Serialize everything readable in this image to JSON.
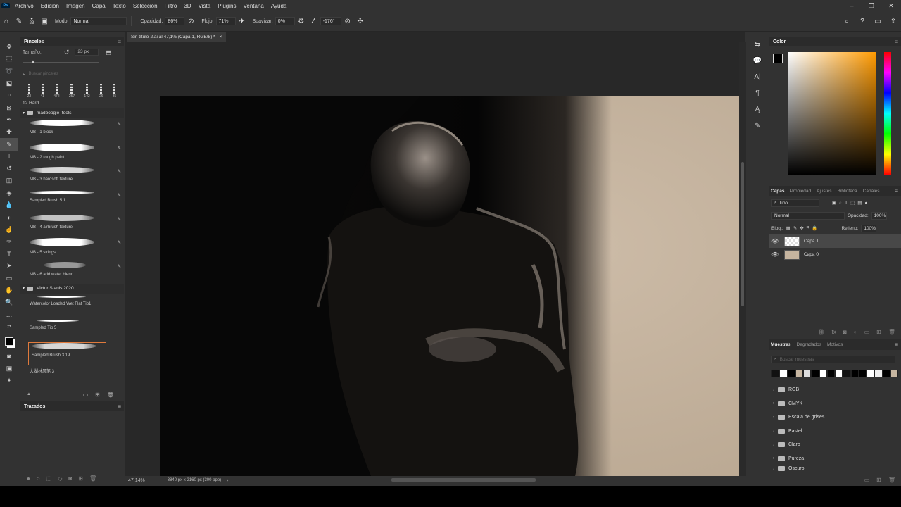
{
  "menu": {
    "items": [
      "Archivo",
      "Edición",
      "Imagen",
      "Capa",
      "Texto",
      "Selección",
      "Filtro",
      "3D",
      "Vista",
      "Plugins",
      "Ventana",
      "Ayuda"
    ]
  },
  "options": {
    "brush_size": "23",
    "mode_label": "Modo:",
    "mode_value": "Normal",
    "opacity_label": "Opacidad:",
    "opacity_value": "86%",
    "flow_label": "Flujo:",
    "flow_value": "71%",
    "smooth_label": "Suavizar:",
    "smooth_value": "0%",
    "angle_value": "-176°"
  },
  "document": {
    "tab_title": "Sin título-2.ai al 47,1% (Capa 1, RGB/8) *",
    "zoom": "47,14%",
    "dimensions": "3840 px x 2160 px (300 ppp)"
  },
  "brushes": {
    "title": "Pinceles",
    "size_label": "Tamaño:",
    "size_value": "23 px",
    "search_placeholder": "Buscar pinceles",
    "presets": [
      "23",
      "41",
      "472",
      "257",
      "142",
      "26",
      "35"
    ],
    "current": "12 Hard",
    "group1": "madboogie_tools",
    "items1": [
      "MB - 1 block",
      "MB - 2 rough paint",
      "MB - 3 hardsoft texture",
      "Sampled Brush 5 1",
      "MB - 4 airbrush texture",
      "MB - 5 strings",
      "MB - 6 add water blend"
    ],
    "group2": "Victor Stanis 2020",
    "items2": [
      "Watercolor Loaded Wet Flat Tip1",
      "Sampled Tip 5",
      "Sampled Brush 3 19",
      "大湖林风笔 3"
    ]
  },
  "paths": {
    "title": "Trazados"
  },
  "color": {
    "title": "Color",
    "base": "#ff9a00"
  },
  "layers": {
    "tabs": [
      "Capas",
      "Propiedad",
      "Ajustes",
      "Biblioteca",
      "Canales"
    ],
    "filter": "Tipo",
    "blend": "Normal",
    "opacity_label": "Opacidad:",
    "opacity_value": "100%",
    "lock_label": "Bloq.:",
    "fill_label": "Relleno:",
    "fill_value": "100%",
    "items": [
      "Capa 1",
      "Capa 0"
    ]
  },
  "swatches": {
    "tabs": [
      "Muestras",
      "Degradados",
      "Motivos"
    ],
    "search_placeholder": "Buscar muestras",
    "folders": [
      "RGB",
      "CMYK",
      "Escala de grises",
      "Pastel",
      "Claro",
      "Pureza",
      "Oscuro"
    ]
  }
}
